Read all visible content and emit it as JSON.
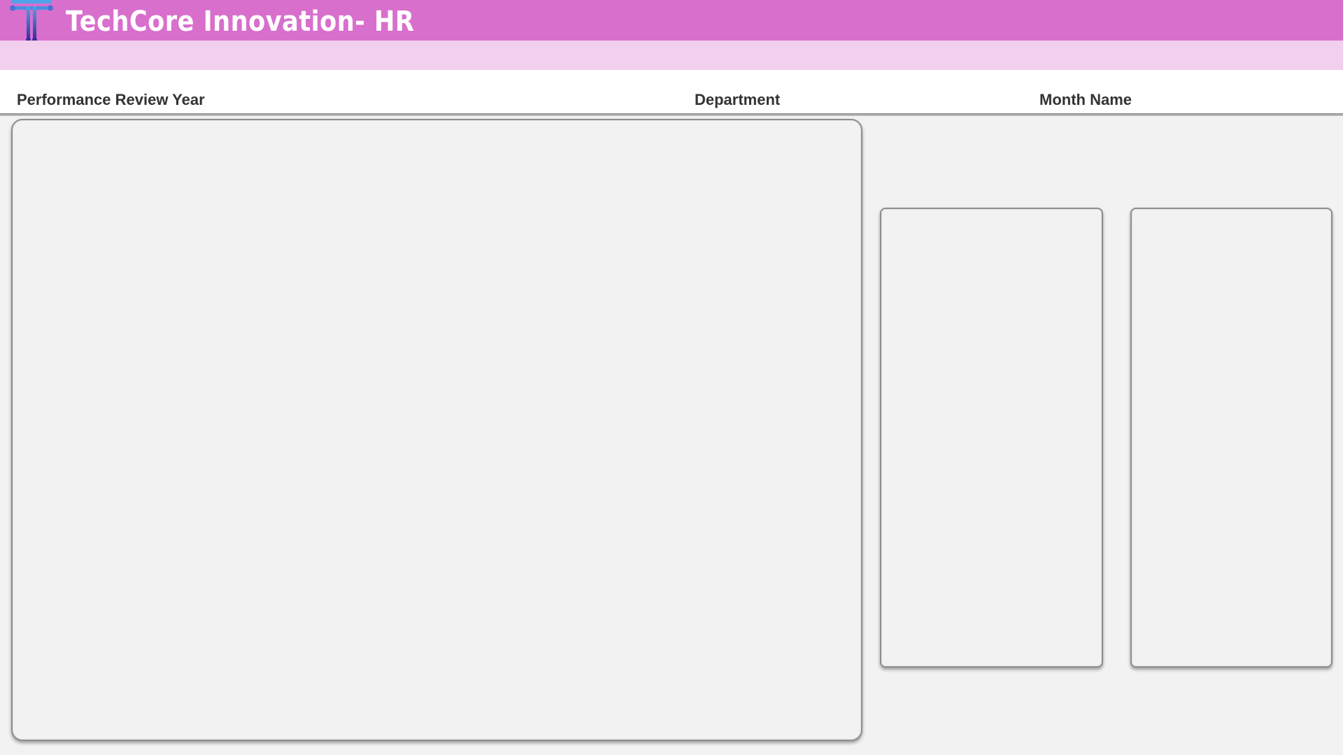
{
  "header": {
    "title": "TechCore Innovation- HR",
    "logo_icon": "techcore-t-logo-icon",
    "colors": {
      "title_bar": "#d86fcc",
      "sub_band": "#f2cfee",
      "logo_light": "#4fa3e8",
      "logo_dark": "#3b2c9a"
    }
  },
  "slicers": {
    "year_label": "Performance Review Year",
    "department_label": "Department",
    "month_label": "Month Name"
  },
  "panels": {
    "background": "#f2f2f2",
    "border": "#8e8e8e"
  }
}
